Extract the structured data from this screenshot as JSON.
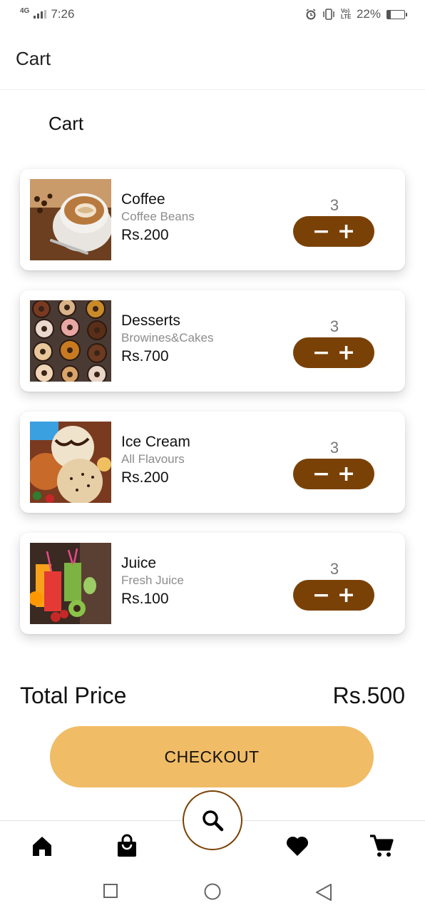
{
  "status_bar": {
    "network": "4G",
    "time": "7:26",
    "volte": "Vo) LTE",
    "battery": "22%",
    "battery_level": 0.22
  },
  "app_bar": {
    "title": "Cart"
  },
  "page": {
    "section_title": "Cart"
  },
  "cart_items": [
    {
      "name": "Coffee",
      "subtitle": "Coffee Beans",
      "price": "Rs.200",
      "quantity": "3",
      "minus": "−",
      "plus": "+"
    },
    {
      "name": "Desserts",
      "subtitle": "Browines&Cakes",
      "price": "Rs.700",
      "quantity": "3",
      "minus": "−",
      "plus": "+"
    },
    {
      "name": "Ice Cream",
      "subtitle": "All Flavours",
      "price": "Rs.200",
      "quantity": "3",
      "minus": "−",
      "plus": "+"
    },
    {
      "name": "Juice",
      "subtitle": "Fresh Juice",
      "price": "Rs.100",
      "quantity": "3",
      "minus": "−",
      "plus": "+"
    }
  ],
  "total": {
    "label": "Total Price",
    "value": "Rs.500"
  },
  "checkout": {
    "label": "CHECKOUT"
  },
  "bottom_nav": {
    "items": [
      "home-icon",
      "shopping-bag-icon",
      "search-icon",
      "heart-icon",
      "cart-icon"
    ]
  },
  "colors": {
    "accent_brown": "#7a4106",
    "checkout_bg": "#f0bc66",
    "text_muted": "#8c8c8c"
  }
}
